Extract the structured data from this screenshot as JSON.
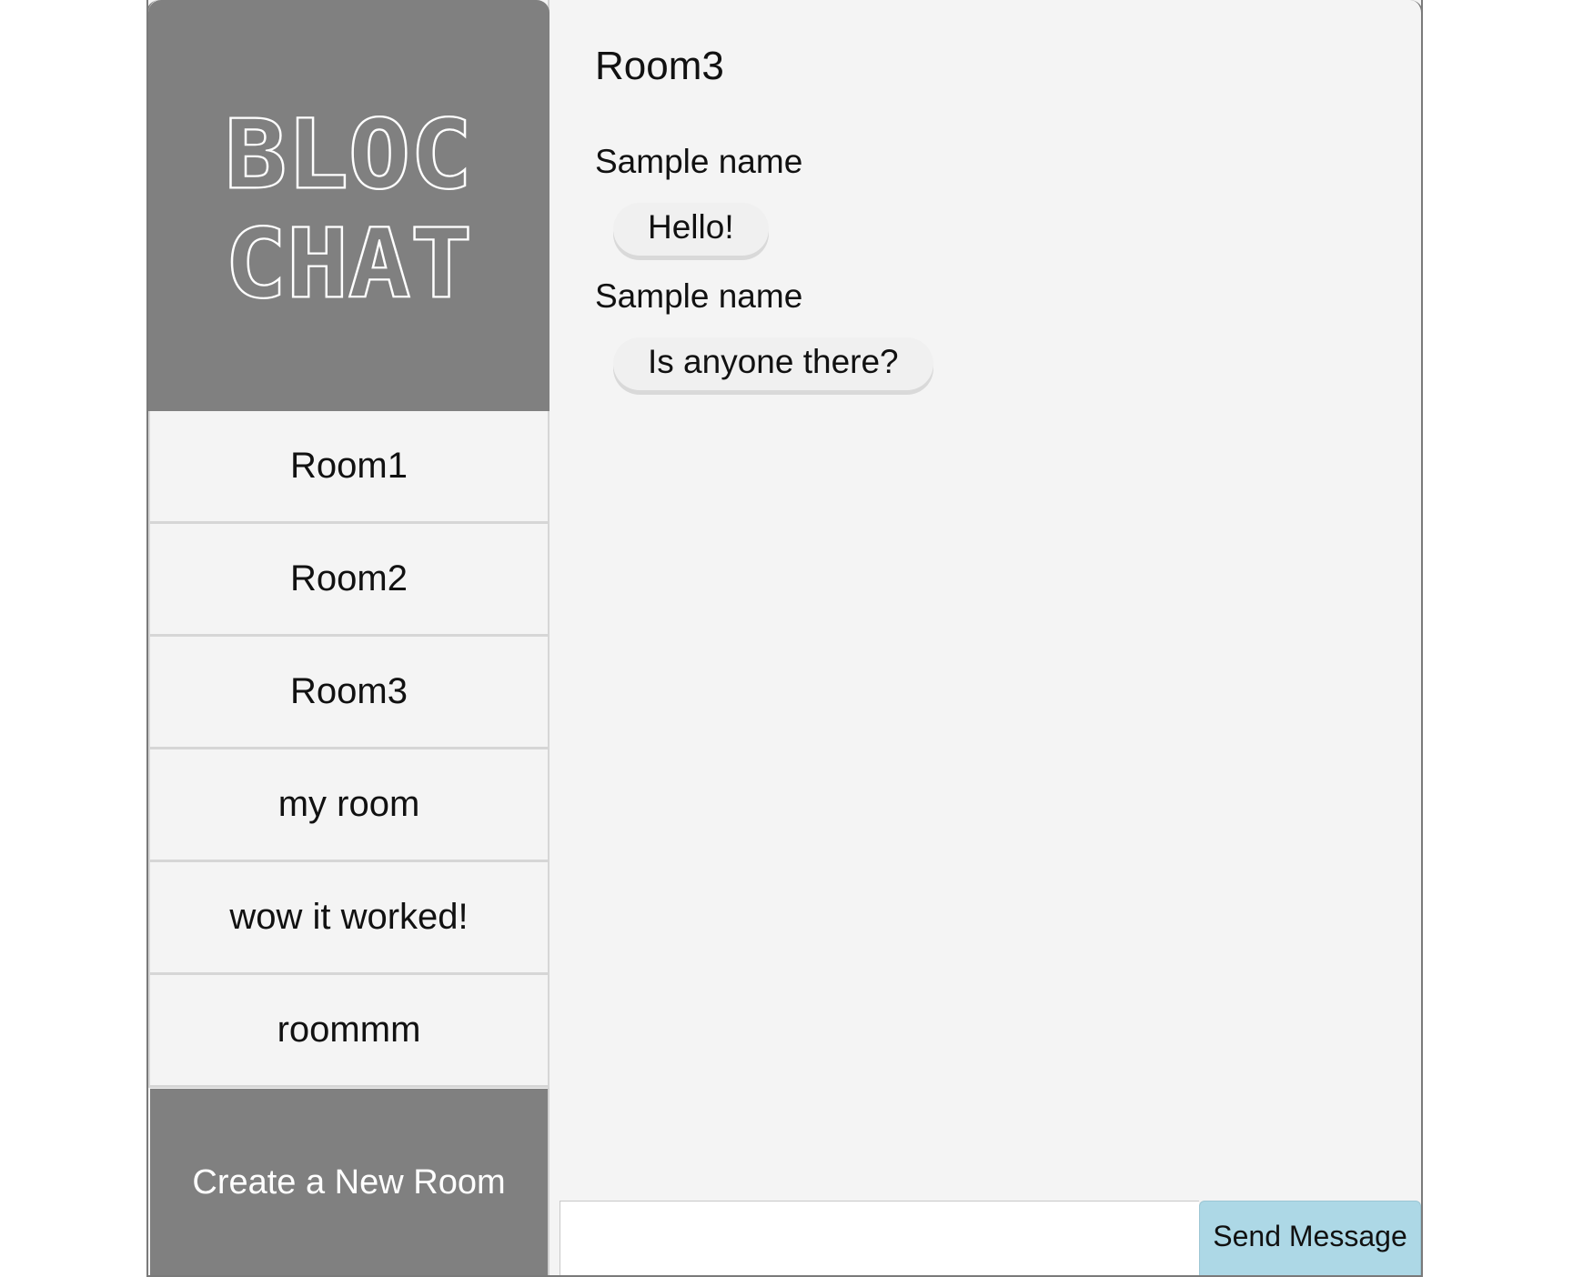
{
  "logo": {
    "line1": "BLOC",
    "line2": "CHAT"
  },
  "sidebar": {
    "rooms": [
      {
        "label": "Room1"
      },
      {
        "label": "Room2"
      },
      {
        "label": "Room3"
      },
      {
        "label": "my room"
      },
      {
        "label": "wow it worked!"
      },
      {
        "label": "roommm"
      }
    ],
    "create_label": "Create a New Room"
  },
  "main": {
    "title": "Room3",
    "messages": [
      {
        "user": "Sample name",
        "text": "Hello!"
      },
      {
        "user": "Sample name",
        "text": "Is anyone there?"
      }
    ]
  },
  "composer": {
    "input_value": "",
    "send_label": "Send Message"
  },
  "colors": {
    "sidebar_header": "#808080",
    "panel_bg": "#f4f4f4",
    "send_button": "#add8e6"
  }
}
